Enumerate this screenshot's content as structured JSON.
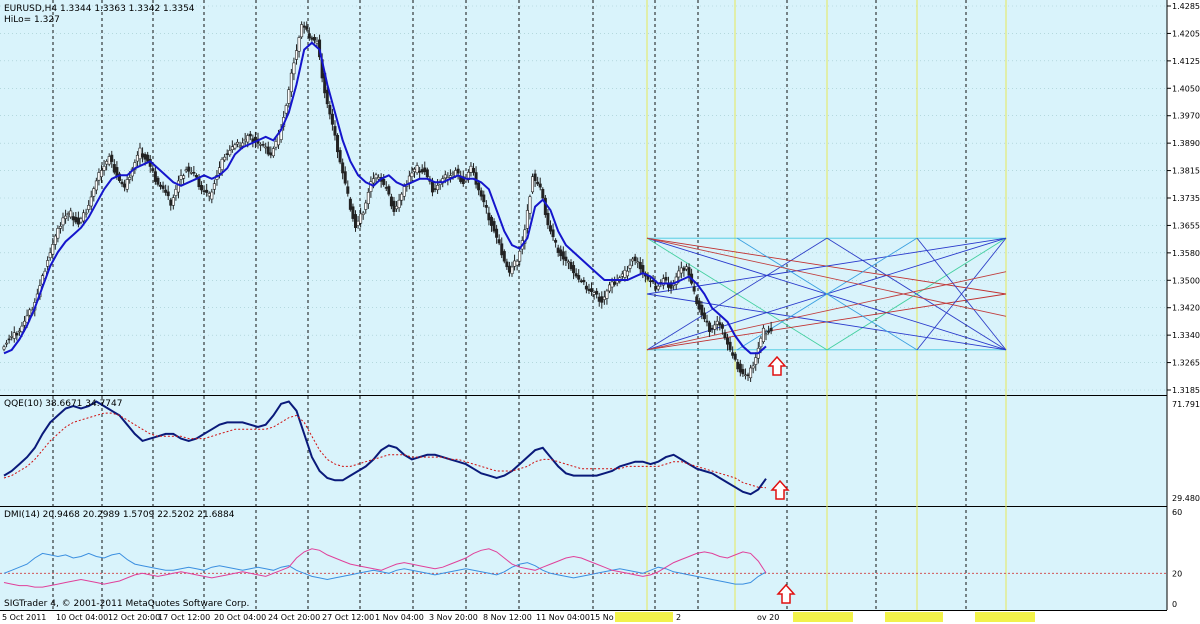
{
  "window": {
    "symbol_header": "EURUSD,H4  1.3344 1.3363 1.3342 1.3354",
    "hilo_label": "HiLo= 1.327",
    "copyright": "SIGTrader 4, © 2001-2011 MetaQuotes Software Corp."
  },
  "colors": {
    "background": "#d9f3fb",
    "grid": "#111111",
    "candle": "#222222",
    "hilo_line": "#1515cc",
    "qqe_main": "#0a1a7a",
    "qqe_signal": "#d01010",
    "dmi_plus": "#3b8fe0",
    "dmi_minus": "#e0409a",
    "level_line": "#e8e85a",
    "arrow_up": "#e01010"
  },
  "chart_data": [
    {
      "type": "candlestick",
      "title": "EURUSD,H4",
      "ylim": [
        3185,
        4285
      ],
      "y_ticks": [
        "1.4285",
        "1.4205",
        "1.4125",
        "1.4050",
        "1.3970",
        "1.3890",
        "1.3815",
        "1.3735",
        "1.3655",
        "1.3580",
        "1.3500",
        "1.3420",
        "1.3340",
        "1.3265",
        "1.3185"
      ],
      "current_price": "1.3354",
      "x_tick_labels": [
        "5 Oct 2011",
        "10 Oct 04:00",
        "12 Oct 20:00",
        "17 Oct 12:00",
        "20 Oct 04:00",
        "24 Oct 20:00",
        "27 Oct 12:00",
        "1 Nov 04:00",
        "3 Nov 20:00",
        "8 Nov 12:00",
        "11 Nov 04:00",
        "15 No",
        "2",
        "ov 20"
      ],
      "close_path": [
        3310,
        3330,
        3350,
        3380,
        3420,
        3480,
        3560,
        3620,
        3680,
        3690,
        3660,
        3700,
        3760,
        3820,
        3850,
        3800,
        3760,
        3820,
        3870,
        3840,
        3790,
        3760,
        3720,
        3780,
        3820,
        3800,
        3760,
        3740,
        3800,
        3860,
        3880,
        3890,
        3910,
        3900,
        3880,
        3860,
        3910,
        4000,
        4130,
        4230,
        4200,
        4180,
        4040,
        3940,
        3840,
        3740,
        3650,
        3700,
        3780,
        3800,
        3760,
        3700,
        3740,
        3800,
        3820,
        3810,
        3760,
        3780,
        3800,
        3810,
        3780,
        3820,
        3760,
        3700,
        3640,
        3580,
        3520,
        3560,
        3640,
        3800,
        3760,
        3660,
        3600,
        3560,
        3540,
        3500,
        3480,
        3460,
        3440,
        3480,
        3500,
        3520,
        3560,
        3540,
        3500,
        3480,
        3500,
        3480,
        3520,
        3540,
        3460,
        3400,
        3360,
        3380,
        3340,
        3280,
        3240,
        3220,
        3280,
        3354
      ],
      "hilo_path": [
        3290,
        3300,
        3330,
        3370,
        3420,
        3480,
        3540,
        3580,
        3610,
        3630,
        3650,
        3680,
        3720,
        3760,
        3790,
        3800,
        3800,
        3820,
        3830,
        3840,
        3820,
        3800,
        3780,
        3770,
        3780,
        3790,
        3800,
        3790,
        3800,
        3820,
        3860,
        3880,
        3890,
        3900,
        3910,
        3900,
        3930,
        3980,
        4060,
        4160,
        4180,
        4160,
        4060,
        3980,
        3900,
        3840,
        3800,
        3780,
        3770,
        3790,
        3800,
        3780,
        3770,
        3780,
        3790,
        3790,
        3780,
        3780,
        3790,
        3800,
        3790,
        3790,
        3780,
        3760,
        3700,
        3640,
        3600,
        3590,
        3620,
        3710,
        3730,
        3700,
        3640,
        3600,
        3580,
        3560,
        3540,
        3520,
        3500,
        3500,
        3500,
        3500,
        3510,
        3520,
        3510,
        3490,
        3490,
        3490,
        3500,
        3510,
        3490,
        3460,
        3420,
        3400,
        3380,
        3340,
        3310,
        3290,
        3290,
        3310
      ],
      "levels": [
        "1.3620",
        "1.3540",
        "1.3460",
        "1.3380",
        "1.3300"
      ],
      "hilo_label": "HiLo= 1.327"
    },
    {
      "type": "line",
      "title": "QQE(10) 38.6671 34.7747",
      "y_ticks": [
        "71.7912",
        "29.4807"
      ],
      "ylim": [
        29.4807,
        71.7912
      ],
      "series": [
        {
          "name": "QQE",
          "values": [
            40,
            42,
            45,
            48,
            52,
            58,
            63,
            66,
            69,
            70,
            69,
            70,
            72,
            70,
            68,
            66,
            62,
            58,
            55,
            56,
            57,
            58,
            58,
            56,
            55,
            56,
            58,
            60,
            62,
            63,
            63,
            63,
            62,
            61,
            62,
            66,
            71,
            72,
            68,
            58,
            48,
            42,
            39,
            38,
            38,
            40,
            42,
            44,
            47,
            51,
            53,
            52,
            49,
            47,
            48,
            49,
            49,
            48,
            47,
            46,
            45,
            43,
            41,
            40,
            39,
            40,
            42,
            45,
            48,
            51,
            52,
            48,
            44,
            41,
            40,
            40,
            40,
            40,
            41,
            42,
            44,
            45,
            46,
            46,
            45,
            46,
            48,
            49,
            47,
            45,
            43,
            42,
            41,
            39,
            37,
            35,
            33,
            32,
            34,
            38.6671
          ]
        },
        {
          "name": "Signal",
          "values": [
            39,
            40,
            42,
            44,
            47,
            51,
            55,
            58,
            61,
            63,
            64,
            65,
            66,
            67,
            67,
            66,
            64,
            62,
            60,
            58,
            57,
            57,
            57,
            57,
            56,
            56,
            56,
            57,
            58,
            59,
            60,
            60,
            60,
            60,
            60,
            61,
            63,
            65,
            66,
            63,
            57,
            51,
            47,
            45,
            44,
            44,
            45,
            46,
            47,
            48,
            49,
            49,
            49,
            48,
            48,
            48,
            48,
            48,
            47,
            47,
            46,
            45,
            44,
            43,
            42,
            42,
            42,
            43,
            44,
            46,
            47,
            47,
            46,
            45,
            44,
            43,
            43,
            43,
            43,
            43,
            43,
            44,
            44,
            44,
            44,
            44,
            45,
            46,
            46,
            45,
            44,
            43,
            42,
            41,
            40,
            39,
            37,
            36,
            35,
            34.7747
          ]
        }
      ]
    },
    {
      "type": "line",
      "title": "DMI(14) 20.9468 20.2989 1.5709 22.5202 21.6884",
      "y_ticks": [
        "60",
        "20",
        "0"
      ],
      "ylim": [
        0,
        60
      ],
      "series": [
        {
          "name": "+DI",
          "values": [
            20,
            22,
            24,
            26,
            30,
            33,
            32,
            31,
            32,
            30,
            31,
            33,
            31,
            30,
            32,
            33,
            29,
            26,
            25,
            24,
            23,
            22,
            22,
            23,
            24,
            23,
            22,
            24,
            25,
            24,
            23,
            22,
            23,
            24,
            23,
            22,
            24,
            25,
            22,
            20,
            18,
            17,
            16,
            17,
            18,
            19,
            20,
            21,
            22,
            21,
            20,
            22,
            23,
            22,
            21,
            20,
            19,
            20,
            21,
            22,
            23,
            22,
            21,
            20,
            19,
            21,
            24,
            26,
            27,
            25,
            22,
            20,
            19,
            18,
            17,
            18,
            19,
            20,
            21,
            22,
            23,
            22,
            21,
            20,
            22,
            24,
            23,
            21,
            20,
            19,
            18,
            17,
            16,
            15,
            14,
            13,
            13,
            14,
            18,
            20.9468
          ]
        },
        {
          "name": "-DI",
          "values": [
            14,
            13,
            12,
            12,
            11,
            11,
            12,
            13,
            14,
            15,
            16,
            15,
            14,
            13,
            14,
            15,
            17,
            19,
            20,
            19,
            18,
            19,
            20,
            21,
            20,
            19,
            18,
            17,
            18,
            19,
            20,
            21,
            20,
            19,
            18,
            20,
            22,
            24,
            30,
            34,
            36,
            35,
            32,
            30,
            28,
            26,
            25,
            24,
            23,
            22,
            24,
            26,
            27,
            26,
            25,
            24,
            23,
            24,
            26,
            28,
            30,
            33,
            35,
            36,
            34,
            30,
            26,
            24,
            23,
            22,
            24,
            26,
            28,
            30,
            31,
            30,
            28,
            26,
            24,
            22,
            21,
            20,
            19,
            18,
            19,
            21,
            24,
            27,
            29,
            31,
            33,
            34,
            33,
            31,
            30,
            32,
            34,
            33,
            28,
            20.2989
          ]
        }
      ]
    }
  ]
}
